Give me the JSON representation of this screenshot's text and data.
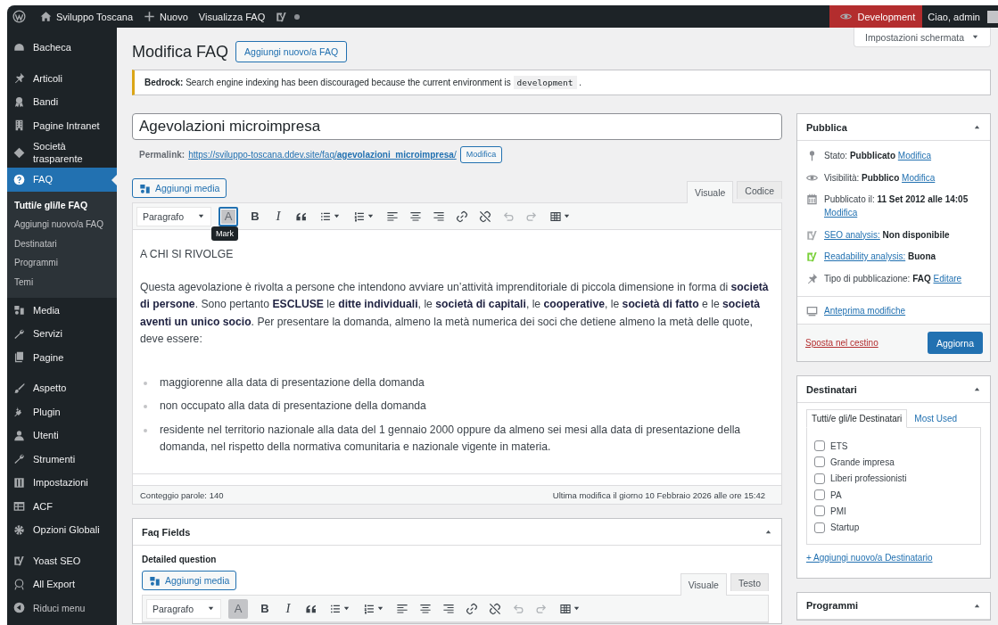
{
  "admin_bar": {
    "site": "Sviluppo Toscana",
    "new": "Nuovo",
    "view": "Visualizza FAQ",
    "environment": "Development",
    "greeting": "Ciao, admin"
  },
  "sidebar": {
    "groups": [
      {
        "items": [
          {
            "label": "Bacheca",
            "selected": false
          }
        ]
      },
      {
        "items": [
          {
            "label": "Articoli",
            "selected": false
          },
          {
            "label": "Bandi",
            "selected": false
          },
          {
            "label": "Pagine Intranet",
            "selected": false
          },
          {
            "label": "Società trasparente",
            "selected": false
          },
          {
            "label": "FAQ",
            "selected": true,
            "children": [
              {
                "label": "Tutti/e gli/le FAQ",
                "selected": true
              },
              {
                "label": "Aggiungi nuovo/a FAQ",
                "selected": false
              },
              {
                "label": "Destinatari",
                "selected": false
              },
              {
                "label": "Programmi",
                "selected": false
              },
              {
                "label": "Temi",
                "selected": false
              }
            ]
          },
          {
            "label": "Media",
            "selected": false
          },
          {
            "label": "Servizi",
            "selected": false
          },
          {
            "label": "Pagine",
            "selected": false
          }
        ]
      },
      {
        "items": [
          {
            "label": "Aspetto",
            "selected": false
          },
          {
            "label": "Plugin",
            "selected": false
          },
          {
            "label": "Utenti",
            "selected": false
          },
          {
            "label": "Strumenti",
            "selected": false
          },
          {
            "label": "Impostazioni",
            "selected": false
          },
          {
            "label": "ACF",
            "selected": false
          },
          {
            "label": "Opzioni Globali",
            "selected": false
          }
        ]
      },
      {
        "items": [
          {
            "label": "Yoast SEO",
            "selected": false
          },
          {
            "label": "All Export",
            "selected": false
          },
          {
            "label": "Riduci menu",
            "selected": false
          }
        ]
      }
    ]
  },
  "screen_options": "Impostazioni schermata",
  "page_title": "Modifica FAQ",
  "add_new": "Aggiungi nuovo/a FAQ",
  "notice": {
    "text": "**Bedrock:** Search engine indexing has been discouraged because the current environment is",
    "code": "development",
    "suffix": "."
  },
  "post_title": "Agevolazioni microimpresa",
  "permalink": {
    "label": "Permalink:",
    "url": "https://sviluppo-toscana.ddev.site/faq/**agevolazioni_microimpresa**/",
    "button": "Modifica"
  },
  "editor": {
    "media_button": "Aggiungi media",
    "tabs": [
      {
        "label": "Visuale",
        "selected": true
      },
      {
        "label": "Codice",
        "selected": false
      }
    ],
    "toolbar": {
      "format": "Paragrafo",
      "buttons": [
        {
          "kind": "mark",
          "label": "A",
          "focused": true,
          "menu": false,
          "disabled": false
        },
        {
          "kind": "bold",
          "label": "B",
          "focused": false,
          "menu": false,
          "disabled": false
        },
        {
          "kind": "italic",
          "label": "I",
          "focused": false,
          "menu": false,
          "disabled": false
        },
        {
          "kind": "quote",
          "focused": false,
          "menu": false,
          "disabled": false
        },
        {
          "kind": "bullets",
          "focused": false,
          "menu": true,
          "disabled": false
        },
        {
          "kind": "numbers",
          "focused": false,
          "menu": true,
          "disabled": false
        },
        {
          "kind": "align-left",
          "focused": false,
          "menu": false,
          "disabled": false
        },
        {
          "kind": "align-center",
          "focused": false,
          "menu": false,
          "disabled": false
        },
        {
          "kind": "align-right",
          "focused": false,
          "menu": false,
          "disabled": false
        },
        {
          "kind": "link",
          "focused": false,
          "menu": false,
          "disabled": false
        },
        {
          "kind": "unlink",
          "focused": false,
          "menu": false,
          "disabled": false
        },
        {
          "kind": "undo",
          "focused": false,
          "menu": false,
          "disabled": true
        },
        {
          "kind": "redo",
          "focused": false,
          "menu": false,
          "disabled": true
        },
        {
          "kind": "table",
          "focused": false,
          "menu": true,
          "disabled": false
        }
      ]
    },
    "tooltip": "Mark",
    "content": [
      {
        "kind": "paragraph",
        "text": "A CHI SI RIVOLGE"
      },
      {
        "kind": "paragraph",
        "text": "Questa agevolazione è rivolta a persone che intendono avviare un’attività imprenditoriale di piccola dimensione in forma di **società di persone**. Sono pertanto **ESCLUSE** le **ditte individuali**, le **società di capitali**, le **cooperative**, le **società di fatto** e le **società aventi un unico socio**. Per presentare la domanda, almeno la metà numerica dei soci che detiene almeno la metà delle quote, deve essere:"
      },
      {
        "kind": "list",
        "items": [
          "maggiorenne alla data di presentazione della domanda",
          "non occupato alla data di presentazione della domanda",
          "residente nel territorio nazionale alla data del 1 gennaio 2000 oppure da almeno sei mesi alla data di presentazione della domanda, nel rispetto della normativa comunitaria e nazionale vigente in materia."
        ]
      }
    ],
    "word_count": "Conteggio parole: 140",
    "last_edit": "Ultima modifica il giorno 10 Febbraio 2026 alle ore 15:42"
  },
  "faq_fields": {
    "title": "Faq Fields",
    "field_label": "Detailed question",
    "media_button": "Aggiungi media",
    "tabs": [
      {
        "label": "Visuale",
        "selected": true
      },
      {
        "label": "Testo",
        "selected": false
      }
    ],
    "toolbar": {
      "format": "Paragrafo",
      "buttons": [
        {
          "kind": "mark",
          "label": "A",
          "focused": false,
          "menu": false,
          "disabled": false
        },
        {
          "kind": "bold",
          "label": "B",
          "focused": false,
          "menu": false,
          "disabled": false
        },
        {
          "kind": "italic",
          "label": "I",
          "focused": false,
          "menu": false,
          "disabled": false
        },
        {
          "kind": "quote",
          "focused": false,
          "menu": false,
          "disabled": false
        },
        {
          "kind": "bullets",
          "focused": false,
          "menu": true,
          "disabled": false
        },
        {
          "kind": "numbers",
          "focused": false,
          "menu": true,
          "disabled": false
        },
        {
          "kind": "align-left",
          "focused": false,
          "menu": false,
          "disabled": false
        },
        {
          "kind": "align-center",
          "focused": false,
          "menu": false,
          "disabled": false
        },
        {
          "kind": "align-right",
          "focused": false,
          "menu": false,
          "disabled": false
        },
        {
          "kind": "link",
          "focused": false,
          "menu": false,
          "disabled": false
        },
        {
          "kind": "unlink",
          "focused": false,
          "menu": false,
          "disabled": false
        },
        {
          "kind": "undo",
          "focused": false,
          "menu": false,
          "disabled": true
        },
        {
          "kind": "redo",
          "focused": false,
          "menu": false,
          "disabled": true
        },
        {
          "kind": "table",
          "focused": false,
          "menu": true,
          "disabled": false
        }
      ]
    }
  },
  "publish": {
    "title": "Pubblica",
    "rows": [
      {
        "kind": "meta",
        "label": "Stato:",
        "value": "Pubblicato",
        "link": "Modifica"
      },
      {
        "kind": "meta",
        "label": "Visibilità:",
        "value": "Pubblico",
        "link": "Modifica"
      },
      {
        "kind": "meta",
        "label": "Pubblicato il:",
        "value": "11 Set 2012 alle 14:05",
        "link": "Modifica"
      },
      {
        "kind": "analysis",
        "link": "SEO analysis:",
        "value": "Non disponibile",
        "color": "#a7aaad"
      },
      {
        "kind": "analysis",
        "link": "Readability analysis:",
        "value": "Buona",
        "color": "#7ad03a"
      },
      {
        "kind": "meta",
        "label": "Tipo di pubblicazione:",
        "value": "FAQ",
        "link": "Editare"
      }
    ],
    "preview": "Anteprima modifiche",
    "trash": "Sposta nel cestino",
    "update": "Aggiorna"
  },
  "destinatari": {
    "title": "Destinatari",
    "tabs": [
      {
        "label": "Tutti/e gli/le Destinatari",
        "selected": true
      },
      {
        "label": "Most Used",
        "selected": false
      }
    ],
    "options": [
      {
        "label": "ETS",
        "checked": false
      },
      {
        "label": "Grande impresa",
        "checked": false
      },
      {
        "label": "Liberi professionisti",
        "checked": false
      },
      {
        "label": "PA",
        "checked": false
      },
      {
        "label": "PMI",
        "checked": false
      },
      {
        "label": "Startup",
        "checked": false
      }
    ],
    "add_link": "+ Aggiungi nuovo/a Destinatario"
  },
  "programmi": {
    "title": "Programmi"
  }
}
